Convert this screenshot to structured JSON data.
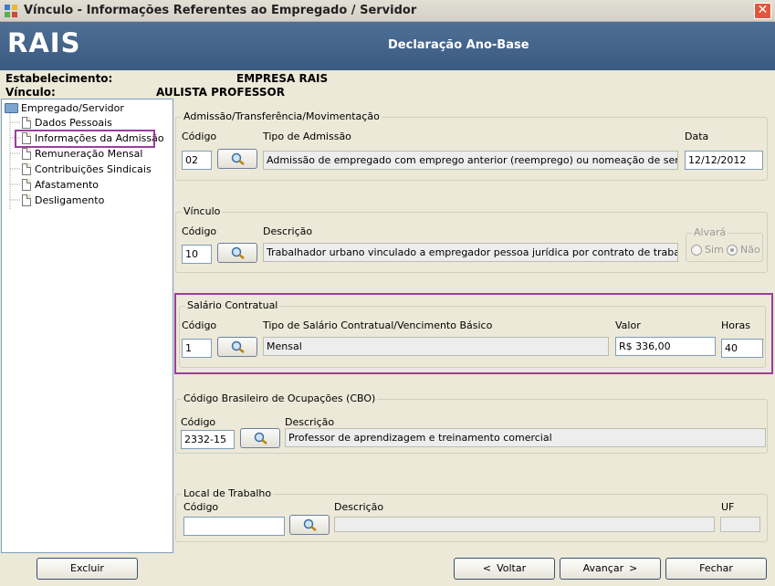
{
  "window": {
    "title": "Vínculo - Informações Referentes ao Empregado / Servidor",
    "close_glyph": "✕"
  },
  "banner": {
    "logo": "RAIS",
    "title": "Declaração Ano-Base"
  },
  "header": {
    "estabelecimento_label": "Estabelecimento:",
    "estabelecimento_value": "EMPRESA RAIS",
    "vinculo_label": "Vínculo:",
    "vinculo_value": "AULISTA PROFESSOR"
  },
  "tree": {
    "root": "Empregado/Servidor",
    "items": [
      "Dados Pessoais",
      "Informações da Admissão",
      "Remuneração Mensal",
      "Contribuições Sindicais",
      "Afastamento",
      "Desligamento"
    ],
    "selected_index": 1
  },
  "admissao": {
    "legend": "Admissão/Transferência/Movimentação",
    "codigo_label": "Código",
    "codigo": "02",
    "tipo_label": "Tipo de Admissão",
    "tipo": "Admissão de empregado com emprego anterior (reemprego) ou nomeação de servidor em cará",
    "data_label": "Data",
    "data": "12/12/2012"
  },
  "vinculo": {
    "legend": "Vínculo",
    "codigo_label": "Código",
    "codigo": "10",
    "descricao_label": "Descrição",
    "descricao": "Trabalhador urbano vinculado a empregador pessoa jurídica por contrato de trabalho regido p",
    "alvara_legend": "Alvará",
    "sim_label": "Sim",
    "nao_label": "Não",
    "alvara_selected": "Não"
  },
  "salario": {
    "legend": "Salário Contratual",
    "codigo_label": "Código",
    "codigo": "1",
    "tipo_label": "Tipo de Salário Contratual/Vencimento Básico",
    "tipo": "Mensal",
    "valor_label": "Valor",
    "valor": "R$ 336,00",
    "horas_label": "Horas",
    "horas": "40"
  },
  "cbo": {
    "legend": "Código Brasileiro de Ocupações (CBO)",
    "codigo_label": "Código",
    "codigo": "2332-15",
    "descricao_label": "Descrição",
    "descricao": "Professor de aprendizagem e treinamento comercial"
  },
  "local": {
    "legend": "Local de Trabalho",
    "codigo_label": "Código",
    "codigo": "",
    "descricao_label": "Descrição",
    "descricao": "",
    "uf_label": "UF",
    "uf": ""
  },
  "buttons": {
    "excluir": "Excluir",
    "voltar": "Voltar",
    "avancar": "Avançar",
    "fechar": "Fechar"
  },
  "colors": {
    "banner": "#3B5A82",
    "highlight": "#9B3E9D",
    "close": "#E0573E"
  }
}
